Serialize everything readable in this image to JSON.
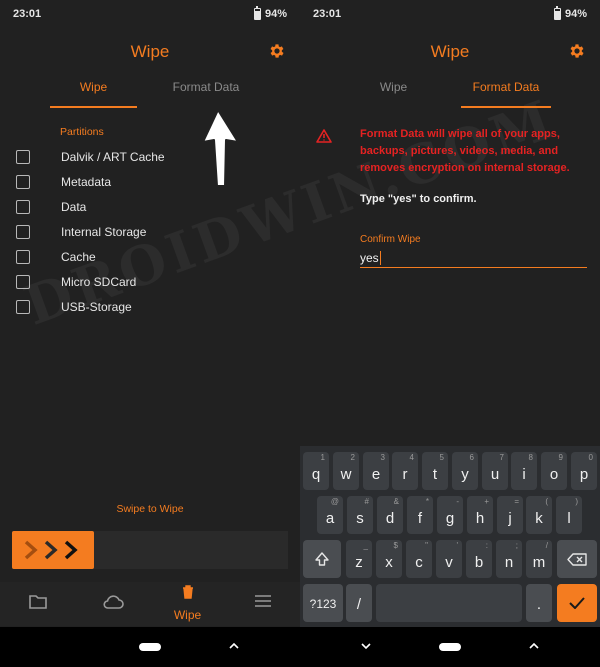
{
  "left": {
    "status": {
      "time": "23:01",
      "battery": "94%"
    },
    "header": {
      "title": "Wipe"
    },
    "tabs": [
      {
        "label": "Wipe",
        "active": true
      },
      {
        "label": "Format Data",
        "active": false
      }
    ],
    "partitions_label": "Partitions",
    "partitions": [
      {
        "label": "Dalvik / ART Cache",
        "checked": false
      },
      {
        "label": "Metadata",
        "checked": false
      },
      {
        "label": "Data",
        "checked": false
      },
      {
        "label": "Internal Storage",
        "checked": false
      },
      {
        "label": "Cache",
        "checked": false
      },
      {
        "label": "Micro SDCard",
        "checked": false
      },
      {
        "label": "USB-Storage",
        "checked": false
      }
    ],
    "swipe_label": "Swipe to Wipe",
    "bottom_nav": {
      "active_label": "Wipe"
    }
  },
  "right": {
    "status": {
      "time": "23:01",
      "battery": "94%"
    },
    "header": {
      "title": "Wipe"
    },
    "tabs": [
      {
        "label": "Wipe",
        "active": false
      },
      {
        "label": "Format Data",
        "active": true
      }
    ],
    "warning": "Format Data will wipe all of your apps, backups, pictures, videos, media, and removes encryption on internal storage.",
    "confirm_prompt": "Type \"yes\" to confirm.",
    "confirm_field": {
      "label": "Confirm Wipe",
      "value": "yes"
    },
    "keyboard": {
      "row1": [
        {
          "key": "q",
          "sup": "1"
        },
        {
          "key": "w",
          "sup": "2"
        },
        {
          "key": "e",
          "sup": "3"
        },
        {
          "key": "r",
          "sup": "4"
        },
        {
          "key": "t",
          "sup": "5"
        },
        {
          "key": "y",
          "sup": "6"
        },
        {
          "key": "u",
          "sup": "7"
        },
        {
          "key": "i",
          "sup": "8"
        },
        {
          "key": "o",
          "sup": "9"
        },
        {
          "key": "p",
          "sup": "0"
        }
      ],
      "row2": [
        {
          "key": "a",
          "sup": "@"
        },
        {
          "key": "s",
          "sup": "#"
        },
        {
          "key": "d",
          "sup": "&"
        },
        {
          "key": "f",
          "sup": "*"
        },
        {
          "key": "g",
          "sup": "-"
        },
        {
          "key": "h",
          "sup": "+"
        },
        {
          "key": "j",
          "sup": "="
        },
        {
          "key": "k",
          "sup": "("
        },
        {
          "key": "l",
          "sup": ")"
        }
      ],
      "row3": [
        {
          "key": "z",
          "sup": "_"
        },
        {
          "key": "x",
          "sup": "$"
        },
        {
          "key": "c",
          "sup": "\""
        },
        {
          "key": "v",
          "sup": "'"
        },
        {
          "key": "b",
          "sup": ":"
        },
        {
          "key": "n",
          "sup": ";"
        },
        {
          "key": "m",
          "sup": "/"
        }
      ],
      "symbols_label": "?123",
      "slash_label": "/",
      "period_label": "."
    }
  },
  "watermark": "DROIDWIN.COM",
  "colors": {
    "accent": "#f47c20",
    "warning": "#e52222",
    "background": "#212121"
  }
}
